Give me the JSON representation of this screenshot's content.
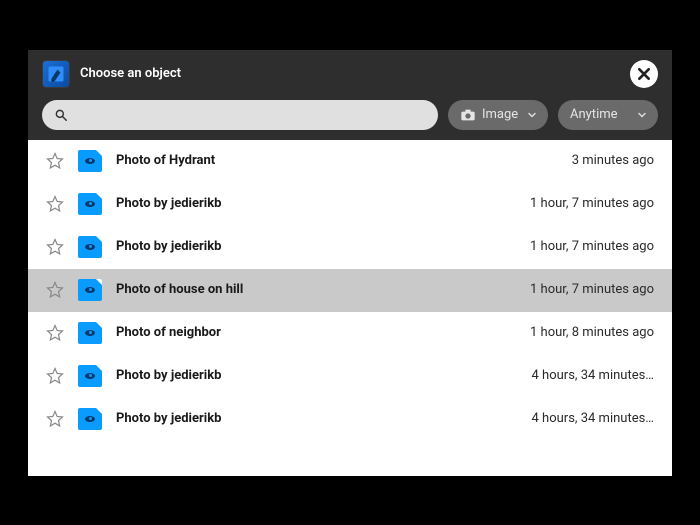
{
  "header": {
    "title": "Choose an object",
    "app_icon": "paint-app-icon",
    "close_icon": "close-icon"
  },
  "search": {
    "value": "",
    "placeholder": ""
  },
  "filters": {
    "type": {
      "label": "Image",
      "icon": "camera-icon"
    },
    "time": {
      "label": "Anytime"
    }
  },
  "items": [
    {
      "title": "Photo of Hydrant",
      "time": "3 minutes ago",
      "starred": false,
      "selected": false
    },
    {
      "title": "Photo by jedierikb",
      "time": "1 hour, 7 minutes ago",
      "starred": false,
      "selected": false
    },
    {
      "title": "Photo by jedierikb",
      "time": "1 hour, 7 minutes ago",
      "starred": false,
      "selected": false
    },
    {
      "title": "Photo of house on hill",
      "time": "1 hour, 7 minutes ago",
      "starred": false,
      "selected": true
    },
    {
      "title": "Photo of neighbor",
      "time": "1 hour, 8 minutes ago",
      "starred": false,
      "selected": false
    },
    {
      "title": "Photo by jedierikb",
      "time": "4 hours, 34 minutes…",
      "starred": false,
      "selected": false
    },
    {
      "title": "Photo by jedierikb",
      "time": "4 hours, 34 minutes…",
      "starred": false,
      "selected": false
    }
  ]
}
